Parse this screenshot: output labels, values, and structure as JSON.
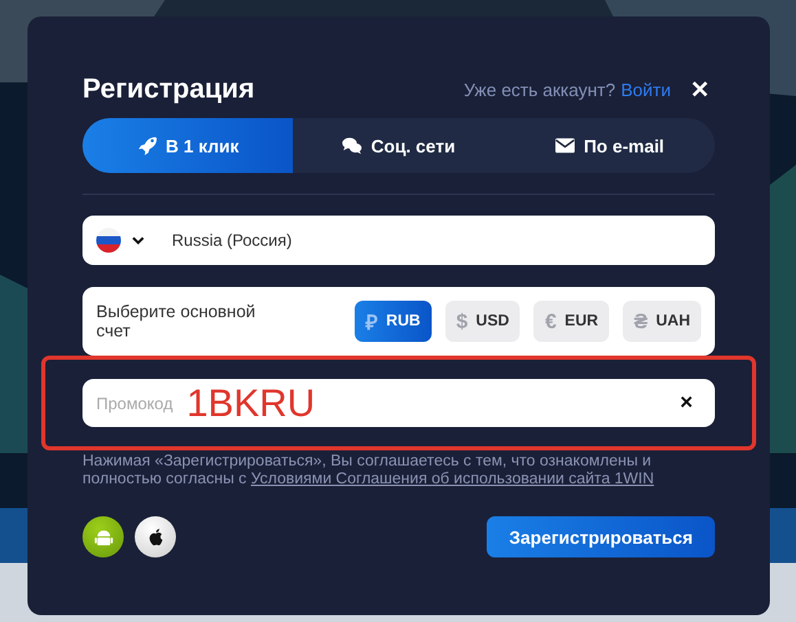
{
  "title": "Регистрация",
  "login_prompt": {
    "text": "Уже есть аккаунт?",
    "link": "Войти"
  },
  "close": "✕",
  "tabs": [
    {
      "label": "В 1 клик",
      "kind": "rocket",
      "selected": true
    },
    {
      "label": "Соц. сети",
      "kind": "chat",
      "selected": false
    },
    {
      "label": "По e-mail",
      "kind": "mail",
      "selected": false
    }
  ],
  "country": {
    "value": "Russia (Россия)"
  },
  "currency": {
    "label": "Выберите основной счет",
    "options": [
      {
        "symbol": "₽",
        "code": "RUB",
        "selected": true
      },
      {
        "symbol": "$",
        "code": "USD",
        "selected": false
      },
      {
        "symbol": "€",
        "code": "EUR",
        "selected": false
      },
      {
        "symbol": "₴",
        "code": "UAH",
        "selected": false
      }
    ]
  },
  "promo": {
    "placeholder": "Промокод",
    "value": "1BKRU",
    "highlighted": true,
    "clear": "×"
  },
  "legal": {
    "text": "Нажимая «Зарегистрироваться», Вы соглашаетесь с тем, что ознакомлены и полностью согласны с",
    "link": "Условиями Соглашения об использовании сайта 1WIN"
  },
  "apps": [
    {
      "kind": "android"
    },
    {
      "kind": "apple"
    }
  ],
  "submit": "Зарегистрироваться"
}
